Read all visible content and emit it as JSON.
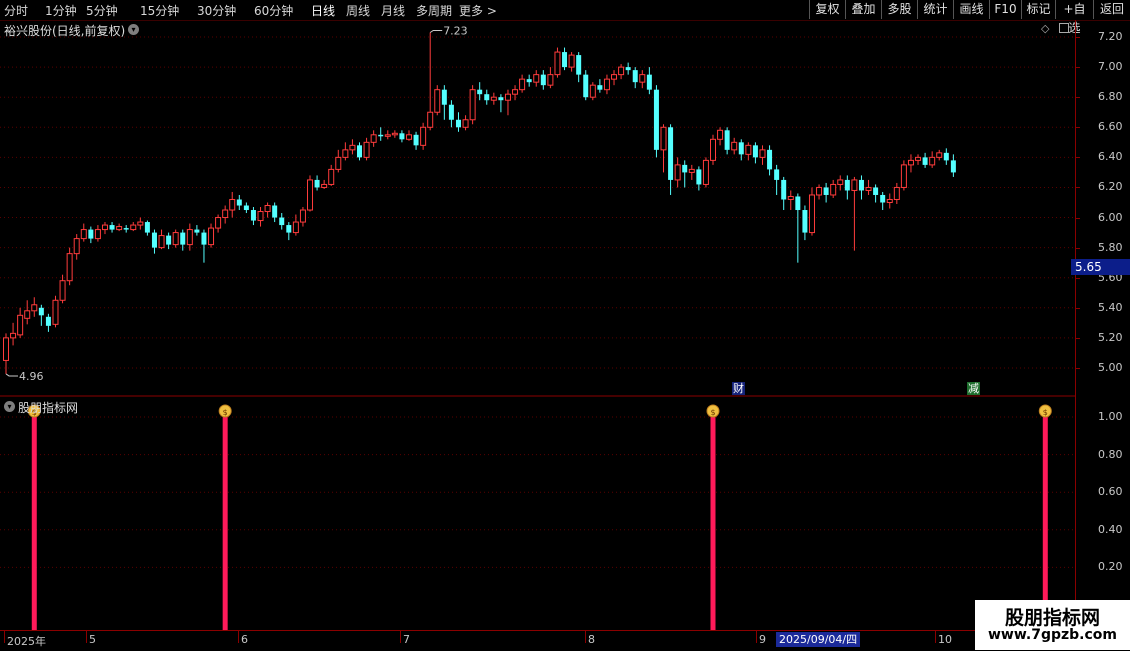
{
  "toolbar": {
    "left_items": [
      "分时",
      "1分钟",
      "5分钟",
      "15分钟",
      "30分钟",
      "60分钟",
      "日线",
      "周线",
      "月线",
      "多周期",
      "更多 >"
    ],
    "active": "日线",
    "right_items": [
      "复权",
      "叠加",
      "多股",
      "统计",
      "画线",
      "F10",
      "标记",
      "+自选",
      "返回"
    ]
  },
  "stock": {
    "title": "裕兴股份(日线,前复权)",
    "high_label": "7.23",
    "low_label": "4.96",
    "current_price": "5.65"
  },
  "price_axis": [
    "7.20",
    "7.00",
    "6.80",
    "6.60",
    "6.40",
    "6.20",
    "6.00",
    "5.80",
    "5.60",
    "5.40",
    "5.20",
    "5.00"
  ],
  "indicator": {
    "title": "股朋指标网",
    "axis": [
      "1.00",
      "0.80",
      "0.60",
      "0.40",
      "0.20"
    ]
  },
  "tags": {
    "cai": "财",
    "jian": "减"
  },
  "dates": {
    "labels": [
      "2025年",
      "5",
      "6",
      "7",
      "8",
      "9",
      "10"
    ],
    "highlight": "2025/09/04/四"
  },
  "watermark": {
    "line1": "股朋指标网",
    "line2": "www.7gpzb.com"
  },
  "colors": {
    "up": "#ff3c3c",
    "down": "#54ffff",
    "signal": "#ff1a5a",
    "grid": "#8b0000"
  },
  "chart_data": {
    "type": "candlestick",
    "y_range": [
      4.9,
      7.28
    ],
    "candles": [
      [
        5.05,
        5.2,
        5.23,
        4.96
      ],
      [
        5.2,
        5.23,
        5.3,
        5.15
      ],
      [
        5.22,
        5.35,
        5.4,
        5.2
      ],
      [
        5.33,
        5.38,
        5.45,
        5.29
      ],
      [
        5.38,
        5.42,
        5.47,
        5.34
      ],
      [
        5.4,
        5.35,
        5.42,
        5.28
      ],
      [
        5.34,
        5.28,
        5.36,
        5.24
      ],
      [
        5.29,
        5.45,
        5.48,
        5.27
      ],
      [
        5.45,
        5.58,
        5.62,
        5.43
      ],
      [
        5.58,
        5.76,
        5.8,
        5.55
      ],
      [
        5.76,
        5.86,
        5.89,
        5.72
      ],
      [
        5.86,
        5.92,
        5.96,
        5.84
      ],
      [
        5.92,
        5.86,
        5.94,
        5.83
      ],
      [
        5.86,
        5.92,
        5.95,
        5.84
      ],
      [
        5.92,
        5.95,
        5.97,
        5.89
      ],
      [
        5.95,
        5.92,
        5.97,
        5.9
      ],
      [
        5.92,
        5.94,
        5.96,
        5.91
      ],
      [
        5.93,
        5.92,
        5.95,
        5.9
      ],
      [
        5.92,
        5.95,
        5.97,
        5.91
      ],
      [
        5.95,
        5.97,
        6.0,
        5.92
      ],
      [
        5.97,
        5.9,
        5.98,
        5.88
      ],
      [
        5.9,
        5.8,
        5.92,
        5.76
      ],
      [
        5.8,
        5.88,
        5.92,
        5.79
      ],
      [
        5.88,
        5.82,
        5.9,
        5.79
      ],
      [
        5.82,
        5.9,
        5.92,
        5.8
      ],
      [
        5.9,
        5.82,
        5.92,
        5.78
      ],
      [
        5.82,
        5.92,
        5.96,
        5.78
      ],
      [
        5.92,
        5.9,
        5.95,
        5.88
      ],
      [
        5.9,
        5.82,
        5.92,
        5.7
      ],
      [
        5.82,
        5.93,
        5.96,
        5.8
      ],
      [
        5.93,
        6.0,
        6.02,
        5.9
      ],
      [
        6.0,
        6.05,
        6.08,
        5.96
      ],
      [
        6.05,
        6.12,
        6.17,
        6.0
      ],
      [
        6.12,
        6.08,
        6.15,
        6.05
      ],
      [
        6.08,
        6.05,
        6.1,
        6.03
      ],
      [
        6.05,
        5.98,
        6.07,
        5.95
      ],
      [
        5.98,
        6.04,
        6.07,
        5.94
      ],
      [
        6.04,
        6.08,
        6.1,
        6.0
      ],
      [
        6.08,
        6.0,
        6.1,
        5.97
      ],
      [
        6.0,
        5.95,
        6.03,
        5.92
      ],
      [
        5.95,
        5.9,
        5.97,
        5.85
      ],
      [
        5.9,
        5.97,
        6.02,
        5.88
      ],
      [
        5.97,
        6.05,
        6.07,
        5.94
      ],
      [
        6.05,
        6.25,
        6.28,
        6.04
      ],
      [
        6.25,
        6.2,
        6.28,
        6.18
      ],
      [
        6.2,
        6.22,
        6.25,
        6.19
      ],
      [
        6.22,
        6.32,
        6.35,
        6.21
      ],
      [
        6.32,
        6.4,
        6.45,
        6.3
      ],
      [
        6.4,
        6.45,
        6.5,
        6.38
      ],
      [
        6.45,
        6.48,
        6.52,
        6.42
      ],
      [
        6.48,
        6.4,
        6.5,
        6.38
      ],
      [
        6.4,
        6.5,
        6.53,
        6.38
      ],
      [
        6.5,
        6.55,
        6.58,
        6.47
      ],
      [
        6.55,
        6.54,
        6.6,
        6.51
      ],
      [
        6.54,
        6.55,
        6.58,
        6.52
      ],
      [
        6.55,
        6.56,
        6.58,
        6.53
      ],
      [
        6.56,
        6.52,
        6.58,
        6.5
      ],
      [
        6.52,
        6.55,
        6.58,
        6.51
      ],
      [
        6.55,
        6.48,
        6.57,
        6.45
      ],
      [
        6.48,
        6.6,
        6.63,
        6.45
      ],
      [
        6.6,
        6.7,
        7.23,
        6.58
      ],
      [
        6.7,
        6.85,
        6.88,
        6.68
      ],
      [
        6.85,
        6.75,
        6.88,
        6.65
      ],
      [
        6.75,
        6.65,
        6.78,
        6.6
      ],
      [
        6.65,
        6.6,
        6.7,
        6.57
      ],
      [
        6.6,
        6.65,
        6.68,
        6.58
      ],
      [
        6.65,
        6.85,
        6.88,
        6.62
      ],
      [
        6.85,
        6.82,
        6.9,
        6.78
      ],
      [
        6.82,
        6.78,
        6.85,
        6.75
      ],
      [
        6.78,
        6.8,
        6.83,
        6.75
      ],
      [
        6.8,
        6.78,
        6.82,
        6.7
      ],
      [
        6.78,
        6.82,
        6.85,
        6.68
      ],
      [
        6.82,
        6.85,
        6.88,
        6.78
      ],
      [
        6.85,
        6.92,
        6.95,
        6.83
      ],
      [
        6.92,
        6.9,
        6.95,
        6.87
      ],
      [
        6.9,
        6.95,
        6.98,
        6.87
      ],
      [
        6.95,
        6.88,
        6.98,
        6.85
      ],
      [
        6.88,
        6.95,
        7.0,
        6.86
      ],
      [
        6.95,
        7.1,
        7.13,
        6.93
      ],
      [
        7.1,
        7.0,
        7.13,
        6.98
      ],
      [
        7.0,
        7.08,
        7.1,
        6.97
      ],
      [
        7.08,
        6.95,
        7.1,
        6.9
      ],
      [
        6.95,
        6.8,
        6.98,
        6.78
      ],
      [
        6.8,
        6.88,
        6.9,
        6.78
      ],
      [
        6.88,
        6.85,
        6.92,
        6.83
      ],
      [
        6.85,
        6.92,
        6.95,
        6.82
      ],
      [
        6.92,
        6.95,
        6.98,
        6.88
      ],
      [
        6.95,
        7.0,
        7.02,
        6.92
      ],
      [
        7.0,
        6.98,
        7.03,
        6.95
      ],
      [
        6.98,
        6.9,
        7.0,
        6.86
      ],
      [
        6.9,
        6.95,
        6.98,
        6.86
      ],
      [
        6.95,
        6.85,
        7.0,
        6.82
      ],
      [
        6.85,
        6.45,
        6.88,
        6.4
      ],
      [
        6.45,
        6.6,
        6.62,
        6.3
      ],
      [
        6.6,
        6.25,
        6.62,
        6.15
      ],
      [
        6.25,
        6.35,
        6.4,
        6.2
      ],
      [
        6.35,
        6.3,
        6.38,
        6.2
      ],
      [
        6.3,
        6.32,
        6.35,
        6.25
      ],
      [
        6.32,
        6.22,
        6.34,
        6.18
      ],
      [
        6.22,
        6.38,
        6.4,
        6.2
      ],
      [
        6.38,
        6.52,
        6.55,
        6.35
      ],
      [
        6.52,
        6.58,
        6.6,
        6.48
      ],
      [
        6.58,
        6.45,
        6.6,
        6.42
      ],
      [
        6.45,
        6.5,
        6.53,
        6.42
      ],
      [
        6.5,
        6.42,
        6.52,
        6.38
      ],
      [
        6.42,
        6.48,
        6.5,
        6.38
      ],
      [
        6.48,
        6.4,
        6.5,
        6.36
      ],
      [
        6.4,
        6.45,
        6.48,
        6.35
      ],
      [
        6.45,
        6.32,
        6.48,
        6.28
      ],
      [
        6.32,
        6.25,
        6.35,
        6.15
      ],
      [
        6.25,
        6.12,
        6.27,
        6.05
      ],
      [
        6.12,
        6.14,
        6.18,
        6.05
      ],
      [
        6.14,
        6.05,
        6.16,
        5.7
      ],
      [
        6.05,
        5.9,
        6.08,
        5.85
      ],
      [
        5.9,
        6.15,
        6.2,
        5.88
      ],
      [
        6.15,
        6.2,
        6.22,
        6.12
      ],
      [
        6.2,
        6.15,
        6.23,
        6.1
      ],
      [
        6.15,
        6.22,
        6.25,
        6.13
      ],
      [
        6.22,
        6.25,
        6.28,
        6.18
      ],
      [
        6.25,
        6.18,
        6.28,
        6.12
      ],
      [
        6.18,
        6.25,
        6.27,
        5.78
      ],
      [
        6.25,
        6.18,
        6.28,
        6.12
      ],
      [
        6.18,
        6.2,
        6.25,
        6.15
      ],
      [
        6.2,
        6.15,
        6.22,
        6.1
      ],
      [
        6.15,
        6.1,
        6.17,
        6.05
      ],
      [
        6.1,
        6.12,
        6.16,
        6.06
      ],
      [
        6.12,
        6.2,
        6.23,
        6.09
      ],
      [
        6.2,
        6.35,
        6.38,
        6.18
      ],
      [
        6.35,
        6.38,
        6.42,
        6.3
      ],
      [
        6.38,
        6.4,
        6.42,
        6.35
      ],
      [
        6.4,
        6.35,
        6.43,
        6.33
      ],
      [
        6.35,
        6.4,
        6.44,
        6.33
      ],
      [
        6.4,
        6.43,
        6.45,
        6.38
      ],
      [
        6.43,
        6.38,
        6.46,
        6.35
      ],
      [
        6.38,
        6.3,
        6.42,
        6.27
      ]
    ],
    "signals": [
      {
        "index": 4,
        "value": 1.0
      },
      {
        "index": 31,
        "value": 1.0
      },
      {
        "index": 100,
        "value": 1.0
      },
      {
        "index": 147,
        "value": 1.0
      }
    ]
  }
}
